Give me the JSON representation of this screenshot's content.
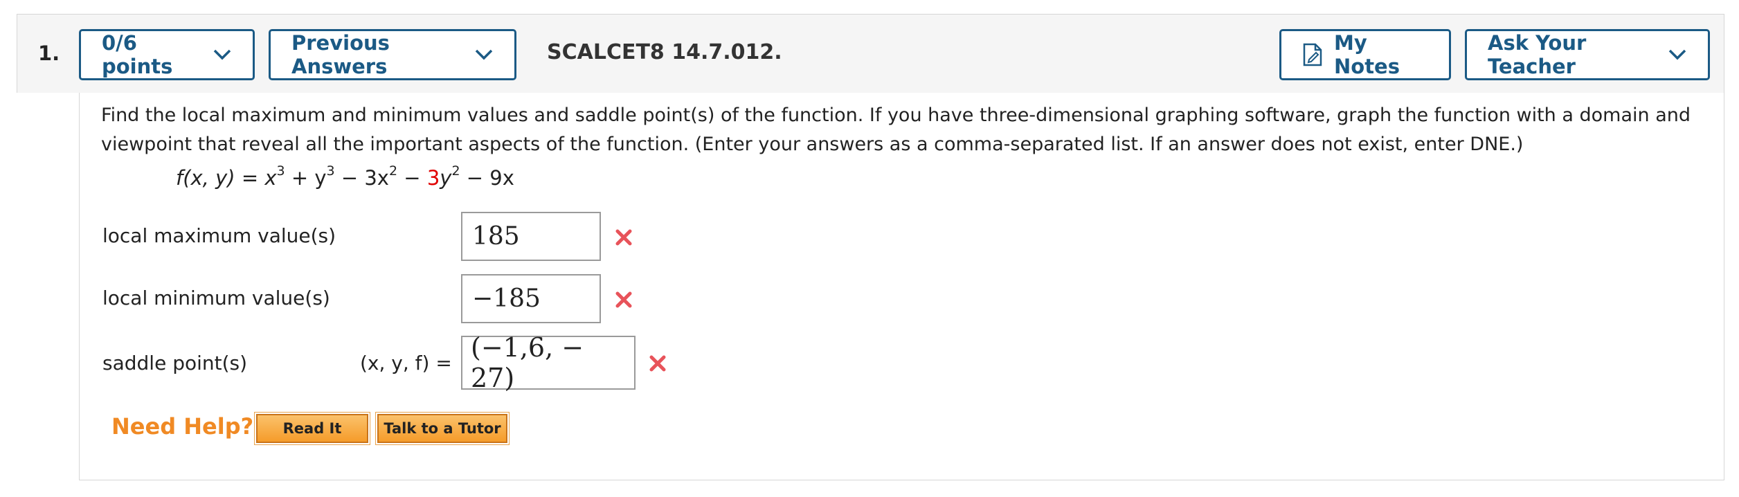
{
  "header": {
    "number": "1.",
    "points": "0/6 points",
    "previous_answers": "Previous Answers",
    "question_id": "SCALCET8 14.7.012.",
    "my_notes": "My Notes",
    "ask_teacher": "Ask Your Teacher"
  },
  "question": {
    "text": "Find the local maximum and minimum values and saddle point(s) of the function. If you have three-dimensional graphing software, graph the function with a domain and viewpoint that reveal all the important aspects of the function. (Enter your answers as a comma-separated list. If an answer does not exist, enter DNE.)",
    "formula": {
      "lhs": "f(x, y) = ",
      "x": "x",
      "exp3": "3",
      "plus_y": " + y",
      "exp3b": "3",
      "minus_3x": " − 3x",
      "exp2": "2",
      "minus": " − ",
      "red_coef": "3",
      "y": "y",
      "exp2b": "2",
      "tail": " − 9x"
    }
  },
  "answers": {
    "local_max_label": "local maximum value(s)",
    "local_max_value": "185",
    "local_min_label": "local minimum value(s)",
    "local_min_value": "−185",
    "saddle_label": "saddle point(s)",
    "saddle_prefix": "(x, y, f) =",
    "saddle_value": "(−1,6, − 27)"
  },
  "help": {
    "label": "Need Help?",
    "read_it": "Read It",
    "tutor": "Talk to a Tutor"
  },
  "colors": {
    "link_blue": "#1b5a85",
    "incorrect_red": "#e8535a",
    "help_orange": "#f08a24"
  },
  "icons": [
    "chevron-down-icon",
    "notes-icon",
    "incorrect-x-icon"
  ]
}
